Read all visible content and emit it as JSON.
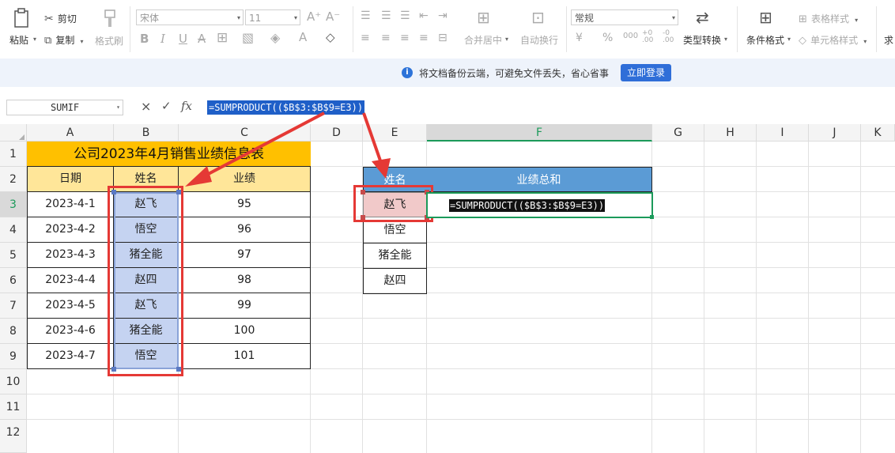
{
  "ribbon": {
    "clipboard": {
      "paste": "粘贴",
      "cut": "剪切",
      "copy": "复制",
      "format_painter": "格式刷"
    },
    "font": {
      "name": "宋体",
      "size": "11"
    },
    "align": {
      "merge": "合并居中",
      "wrap": "自动换行"
    },
    "number": {
      "format": "常规",
      "convert": "类型转换"
    },
    "styles": {
      "cond_format": "条件格式",
      "table_style": "表格样式",
      "cell_style": "单元格样式",
      "sum_partial": "求"
    }
  },
  "notice": {
    "text": "将文档备份云端，可避免文件丢失，省心省事",
    "button": "立即登录"
  },
  "formula_bar": {
    "name_box": "SUMIF",
    "cancel": "×",
    "confirm": "✓",
    "fx": "fx",
    "formula": "=SUMPRODUCT(($B$3:$B$9=E3))"
  },
  "columns": [
    "A",
    "B",
    "C",
    "D",
    "E",
    "F",
    "G",
    "H",
    "I",
    "J",
    "K"
  ],
  "rows": [
    "1",
    "2",
    "3",
    "4",
    "5",
    "6",
    "7",
    "8",
    "9",
    "10",
    "11",
    "12"
  ],
  "table1": {
    "title": "公司2023年4月销售业绩信息表",
    "headers": [
      "日期",
      "姓名",
      "业绩"
    ],
    "records": [
      {
        "date": "2023-4-1",
        "name": "赵飞",
        "value": "95"
      },
      {
        "date": "2023-4-2",
        "name": "悟空",
        "value": "96"
      },
      {
        "date": "2023-4-3",
        "name": "猪全能",
        "value": "97"
      },
      {
        "date": "2023-4-4",
        "name": "赵四",
        "value": "98"
      },
      {
        "date": "2023-4-5",
        "name": "赵飞",
        "value": "99"
      },
      {
        "date": "2023-4-6",
        "name": "猪全能",
        "value": "100"
      },
      {
        "date": "2023-4-7",
        "name": "悟空",
        "value": "101"
      }
    ]
  },
  "table2": {
    "headers": [
      "姓名",
      "业绩总和"
    ],
    "names": [
      "赵飞",
      "悟空",
      "猪全能",
      "赵四"
    ],
    "f3_formula": "=SUMPRODUCT(($B$3:$B$9=E3))"
  },
  "colors": {
    "title_bg": "#ffc000",
    "header_bg": "#ffe699",
    "blue_header": "#5b9bd5",
    "name_sel": "#c5d3f1",
    "red": "#e53935",
    "e3_bg": "#f1c9c9",
    "accent": "#1b9a5a"
  }
}
